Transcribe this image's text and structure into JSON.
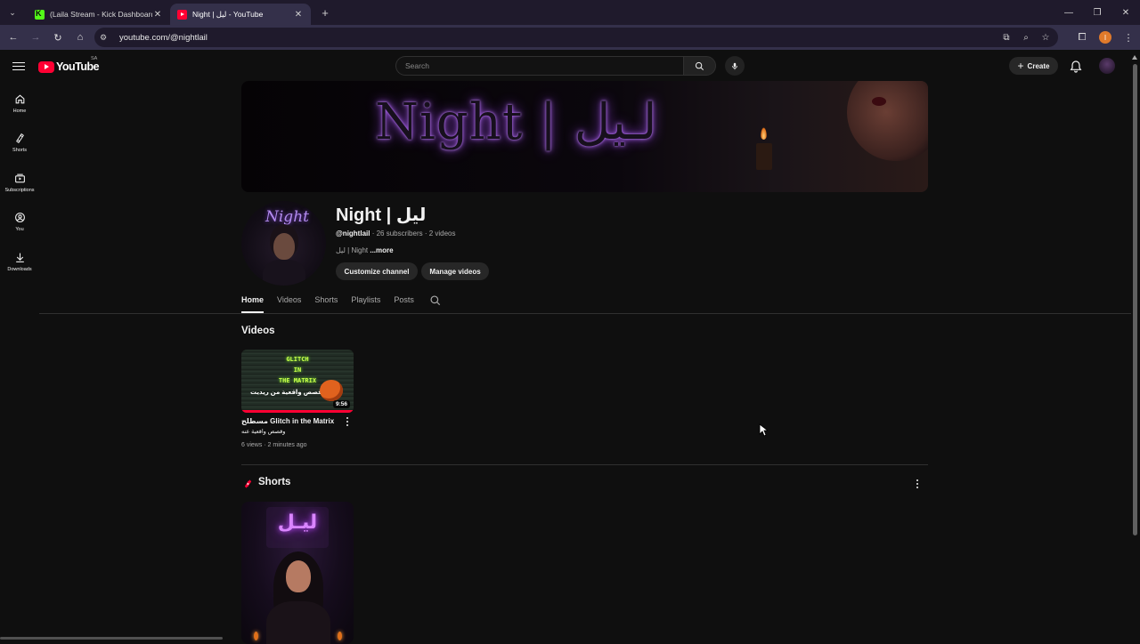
{
  "browser": {
    "tabs": [
      {
        "title": "(Laila Stream - Kick Dashboard",
        "favicon": "kick-favicon",
        "active": false
      },
      {
        "title": "Night | ليل - YouTube",
        "favicon": "youtube-favicon",
        "active": true
      }
    ],
    "url": "youtube.com/@nightlail"
  },
  "header": {
    "logo_text": "YouTube",
    "country_code": "SA",
    "search_placeholder": "Search",
    "create_label": "Create"
  },
  "rail": [
    {
      "label": "Home",
      "icon": "home-icon"
    },
    {
      "label": "Shorts",
      "icon": "shorts-icon"
    },
    {
      "label": "Subscriptions",
      "icon": "subscriptions-icon"
    },
    {
      "label": "You",
      "icon": "you-icon"
    },
    {
      "label": "Downloads",
      "icon": "downloads-icon"
    }
  ],
  "banner": {
    "text": "Night | لـيل"
  },
  "avatar": {
    "text": "Night"
  },
  "channel": {
    "name": "Night | ليل",
    "handle": "@nightlail",
    "stats": " · 26 subscribers · 2 videos",
    "description": "ليل | Night ",
    "more": "...more",
    "customize_label": "Customize channel",
    "manage_label": "Manage videos"
  },
  "tabs": [
    {
      "label": "Home",
      "active": true
    },
    {
      "label": "Videos",
      "active": false
    },
    {
      "label": "Shorts",
      "active": false
    },
    {
      "label": "Playlists",
      "active": false
    },
    {
      "label": "Posts",
      "active": false
    }
  ],
  "videos_section": {
    "title": "Videos",
    "items": [
      {
        "thumb_lines": [
          "GLITCH",
          "IN",
          "THE MATRIX"
        ],
        "thumb_ar": "قصص واقعية من ريديت",
        "duration": "9:56",
        "progress": 1.0,
        "title": "مسطلح Glitch in the Matrix",
        "subtitle": "وقصص واقعية عنه",
        "meta": "6 views · 2 minutes ago"
      }
    ]
  },
  "shorts_section": {
    "title": "Shorts",
    "items": [
      {
        "thumb_text": "ليـل"
      }
    ]
  },
  "colors": {
    "background": "#0f0f0f",
    "accent": "#ff0033",
    "neon": "#b04ae8"
  }
}
